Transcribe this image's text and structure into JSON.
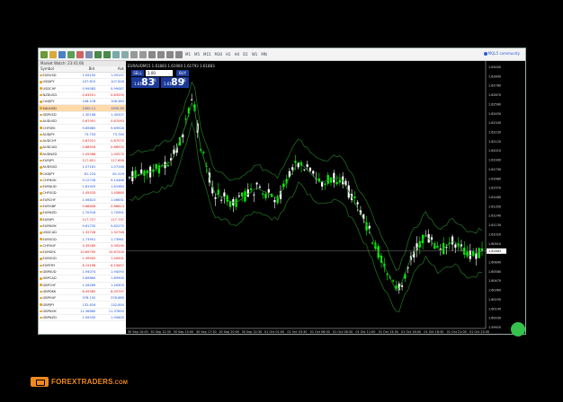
{
  "toolbar": {
    "timeframes": [
      "M1",
      "M5",
      "M15",
      "M30",
      "H1",
      "H4",
      "D1",
      "W1",
      "MN"
    ],
    "community_label": "MQL5 community",
    "icons": [
      "new-chart-icon",
      "profiles-icon",
      "market-watch-icon",
      "data-window-icon",
      "navigator-icon",
      "terminal-icon",
      "zoom-in-icon",
      "zoom-out-icon",
      "tile-icon",
      "scroll-icon",
      "cursor-icon",
      "crosshair-icon",
      "line-icon",
      "trendline-icon",
      "text-icon",
      "objects-icon"
    ]
  },
  "market_watch": {
    "title": "Market Watch: 23:41:06",
    "columns": [
      "Symbol",
      "Bid",
      "Ask"
    ],
    "rows": [
      {
        "symbol": "EURUSD",
        "bid": "1.09155",
        "ask": "1.09157",
        "dir": "up"
      },
      {
        "symbol": "USDJPY",
        "bid": "107.815",
        "ask": "107.818",
        "dir": "up"
      },
      {
        "symbol": "USDCHF",
        "bid": "0.99083",
        "ask": "0.99087",
        "dir": "up"
      },
      {
        "symbol": "NZDUSD",
        "bid": "0.63551",
        "ask": "0.63555",
        "dir": "dn"
      },
      {
        "symbol": "CADJPY",
        "bid": "108.478",
        "ask": "108.483",
        "dir": "up"
      },
      {
        "symbol": "XAUUSD",
        "bid": "1590.11",
        "ask": "1590.55",
        "dir": "up",
        "selected": true
      },
      {
        "symbol": "GBPUSD",
        "bid": "1.30198",
        "ask": "1.30207",
        "dir": "up"
      },
      {
        "symbol": "AUDUSD",
        "bid": "0.67091",
        "ask": "0.67093",
        "dir": "dn"
      },
      {
        "symbol": "CHFSEK",
        "bid": "9.69865",
        "ask": "9.69928",
        "dir": "up"
      },
      {
        "symbol": "AUDJPY",
        "bid": "73.753",
        "ask": "73.760",
        "dir": "up"
      },
      {
        "symbol": "AUDCHF",
        "bid": "0.67021",
        "ask": "0.67075",
        "dir": "dn"
      },
      {
        "symbol": "AUDCAD",
        "bid": "0.88918",
        "ask": "0.88925",
        "dir": "dn"
      },
      {
        "symbol": "AUDNZD",
        "bid": "1.05566",
        "ask": "1.05575",
        "dir": "dn"
      },
      {
        "symbol": "EURJPY",
        "bid": "117.651",
        "ask": "117.658",
        "dir": "dn"
      },
      {
        "symbol": "AUDSGD",
        "bid": "1.07161",
        "ask": "1.07248",
        "dir": "up"
      },
      {
        "symbol": "CADJPY",
        "bid": "81.224",
        "ask": "81.229",
        "dir": "up"
      },
      {
        "symbol": "CHFNOK",
        "bid": "9.12726",
        "ask": "9.14466",
        "dir": "up"
      },
      {
        "symbol": "EURAUD",
        "bid": "1.61925",
        "ask": "1.61983",
        "dir": "up"
      },
      {
        "symbol": "CHFSGD",
        "bid": "1.45533",
        "ask": "1.45865",
        "dir": "dn"
      },
      {
        "symbol": "EURCHF",
        "bid": "1.06623",
        "ask": "1.06631",
        "dir": "up"
      },
      {
        "symbol": "EURGBP",
        "bid": "0.88608",
        "ask": "0.88613",
        "dir": "dn"
      },
      {
        "symbol": "EURNZD",
        "bid": "1.70918",
        "ask": "1.70991",
        "dir": "up"
      },
      {
        "symbol": "EURJPY",
        "bid": "117.727",
        "ask": "117.737",
        "dir": "dn"
      },
      {
        "symbol": "EURNOK",
        "bid": "9.81735",
        "ask": "9.82275",
        "dir": "up"
      },
      {
        "symbol": "USDCAD",
        "bid": "1.32728",
        "ask": "1.32748",
        "dir": "dn"
      },
      {
        "symbol": "EURSGD",
        "bid": "1.73951",
        "ask": "1.73961",
        "dir": "up"
      },
      {
        "symbol": "CHFHUF",
        "bid": "3.39285",
        "ask": "3.39290",
        "dir": "dn"
      },
      {
        "symbol": "EURSEK",
        "bid": "10.69790",
        "ask": "10.67200",
        "dir": "dn"
      },
      {
        "symbol": "EURSGD",
        "bid": "1.39905",
        "ask": "1.40001",
        "dir": "dn"
      },
      {
        "symbol": "EURTRY",
        "bid": "6.15198",
        "ask": "6.15657",
        "dir": "dn"
      },
      {
        "symbol": "GBPAUD",
        "bid": "1.94074",
        "ask": "1.94093",
        "dir": "up"
      },
      {
        "symbol": "GBPCAD",
        "bid": "1.69860",
        "ask": "1.69900",
        "dir": "up"
      },
      {
        "symbol": "GBPCHF",
        "bid": "1.26289",
        "ask": "1.26303",
        "dir": "up"
      },
      {
        "symbol": "GBPDKK",
        "bid": "8.45582",
        "ask": "8.45797",
        "dir": "dn"
      },
      {
        "symbol": "GBPHUF",
        "bid": "378.192",
        "ask": "378.689",
        "dir": "up"
      },
      {
        "symbol": "GBPJPY",
        "bid": "132.816",
        "ask": "132.850",
        "dir": "up"
      },
      {
        "symbol": "GBPNOK",
        "bid": "11.36660",
        "ask": "11.37850",
        "dir": "up"
      },
      {
        "symbol": "GBPNZD",
        "bid": "1.95535",
        "ask": "1.95605",
        "dir": "up"
      }
    ]
  },
  "chart": {
    "title": "EURAUDM15  1.61883  1.61900  1.61793  1.61883",
    "trade_panel": {
      "sell_label": "SELL",
      "buy_label": "BUY",
      "lot": "1.00",
      "sell_prefix": "1.61",
      "sell_big": "83",
      "sell_sup": "0",
      "buy_prefix": "1.61",
      "buy_big": "89",
      "buy_sup": "6"
    },
    "price_labels": [
      "1.63000",
      "1.62890",
      "1.62780",
      "1.62670",
      "1.62560",
      "1.62450",
      "1.62340",
      "1.62230",
      "1.62120",
      "1.62010",
      "1.61900",
      "1.61790",
      "1.61680",
      "1.61570",
      "1.61460",
      "1.61350",
      "1.61240",
      "1.61130",
      "1.61020",
      "1.60910",
      "1.60800",
      "1.60690",
      "1.60580",
      "1.60470",
      "1.60360",
      "1.60250",
      "1.60140",
      "1.60030",
      "1.59920"
    ],
    "current_price": "1.61883",
    "time_labels": [
      "30 Sep 10:00",
      "30 Sep 12:30",
      "30 Sep 15:00",
      "30 Sep 17:30",
      "30 Sep 20:00",
      "30 Sep 22:30",
      "01 Oct 01:00",
      "01 Oct 03:30",
      "01 Oct 06:00",
      "01 Oct 08:30",
      "01 Oct 11:00",
      "01 Oct 13:30",
      "01 Oct 16:00",
      "01 Oct 18:30",
      "01 Oct 21:00",
      "01 Oct 23:30"
    ],
    "colors": {
      "bull": "#00ff00",
      "bear": "#ffffff",
      "bands": "#1f6b1f",
      "ma": "#2c8a2c",
      "bg": "#000000"
    }
  },
  "footer": {
    "brand": "FOREXTRADERS",
    "brand_suffix": ".COM"
  }
}
